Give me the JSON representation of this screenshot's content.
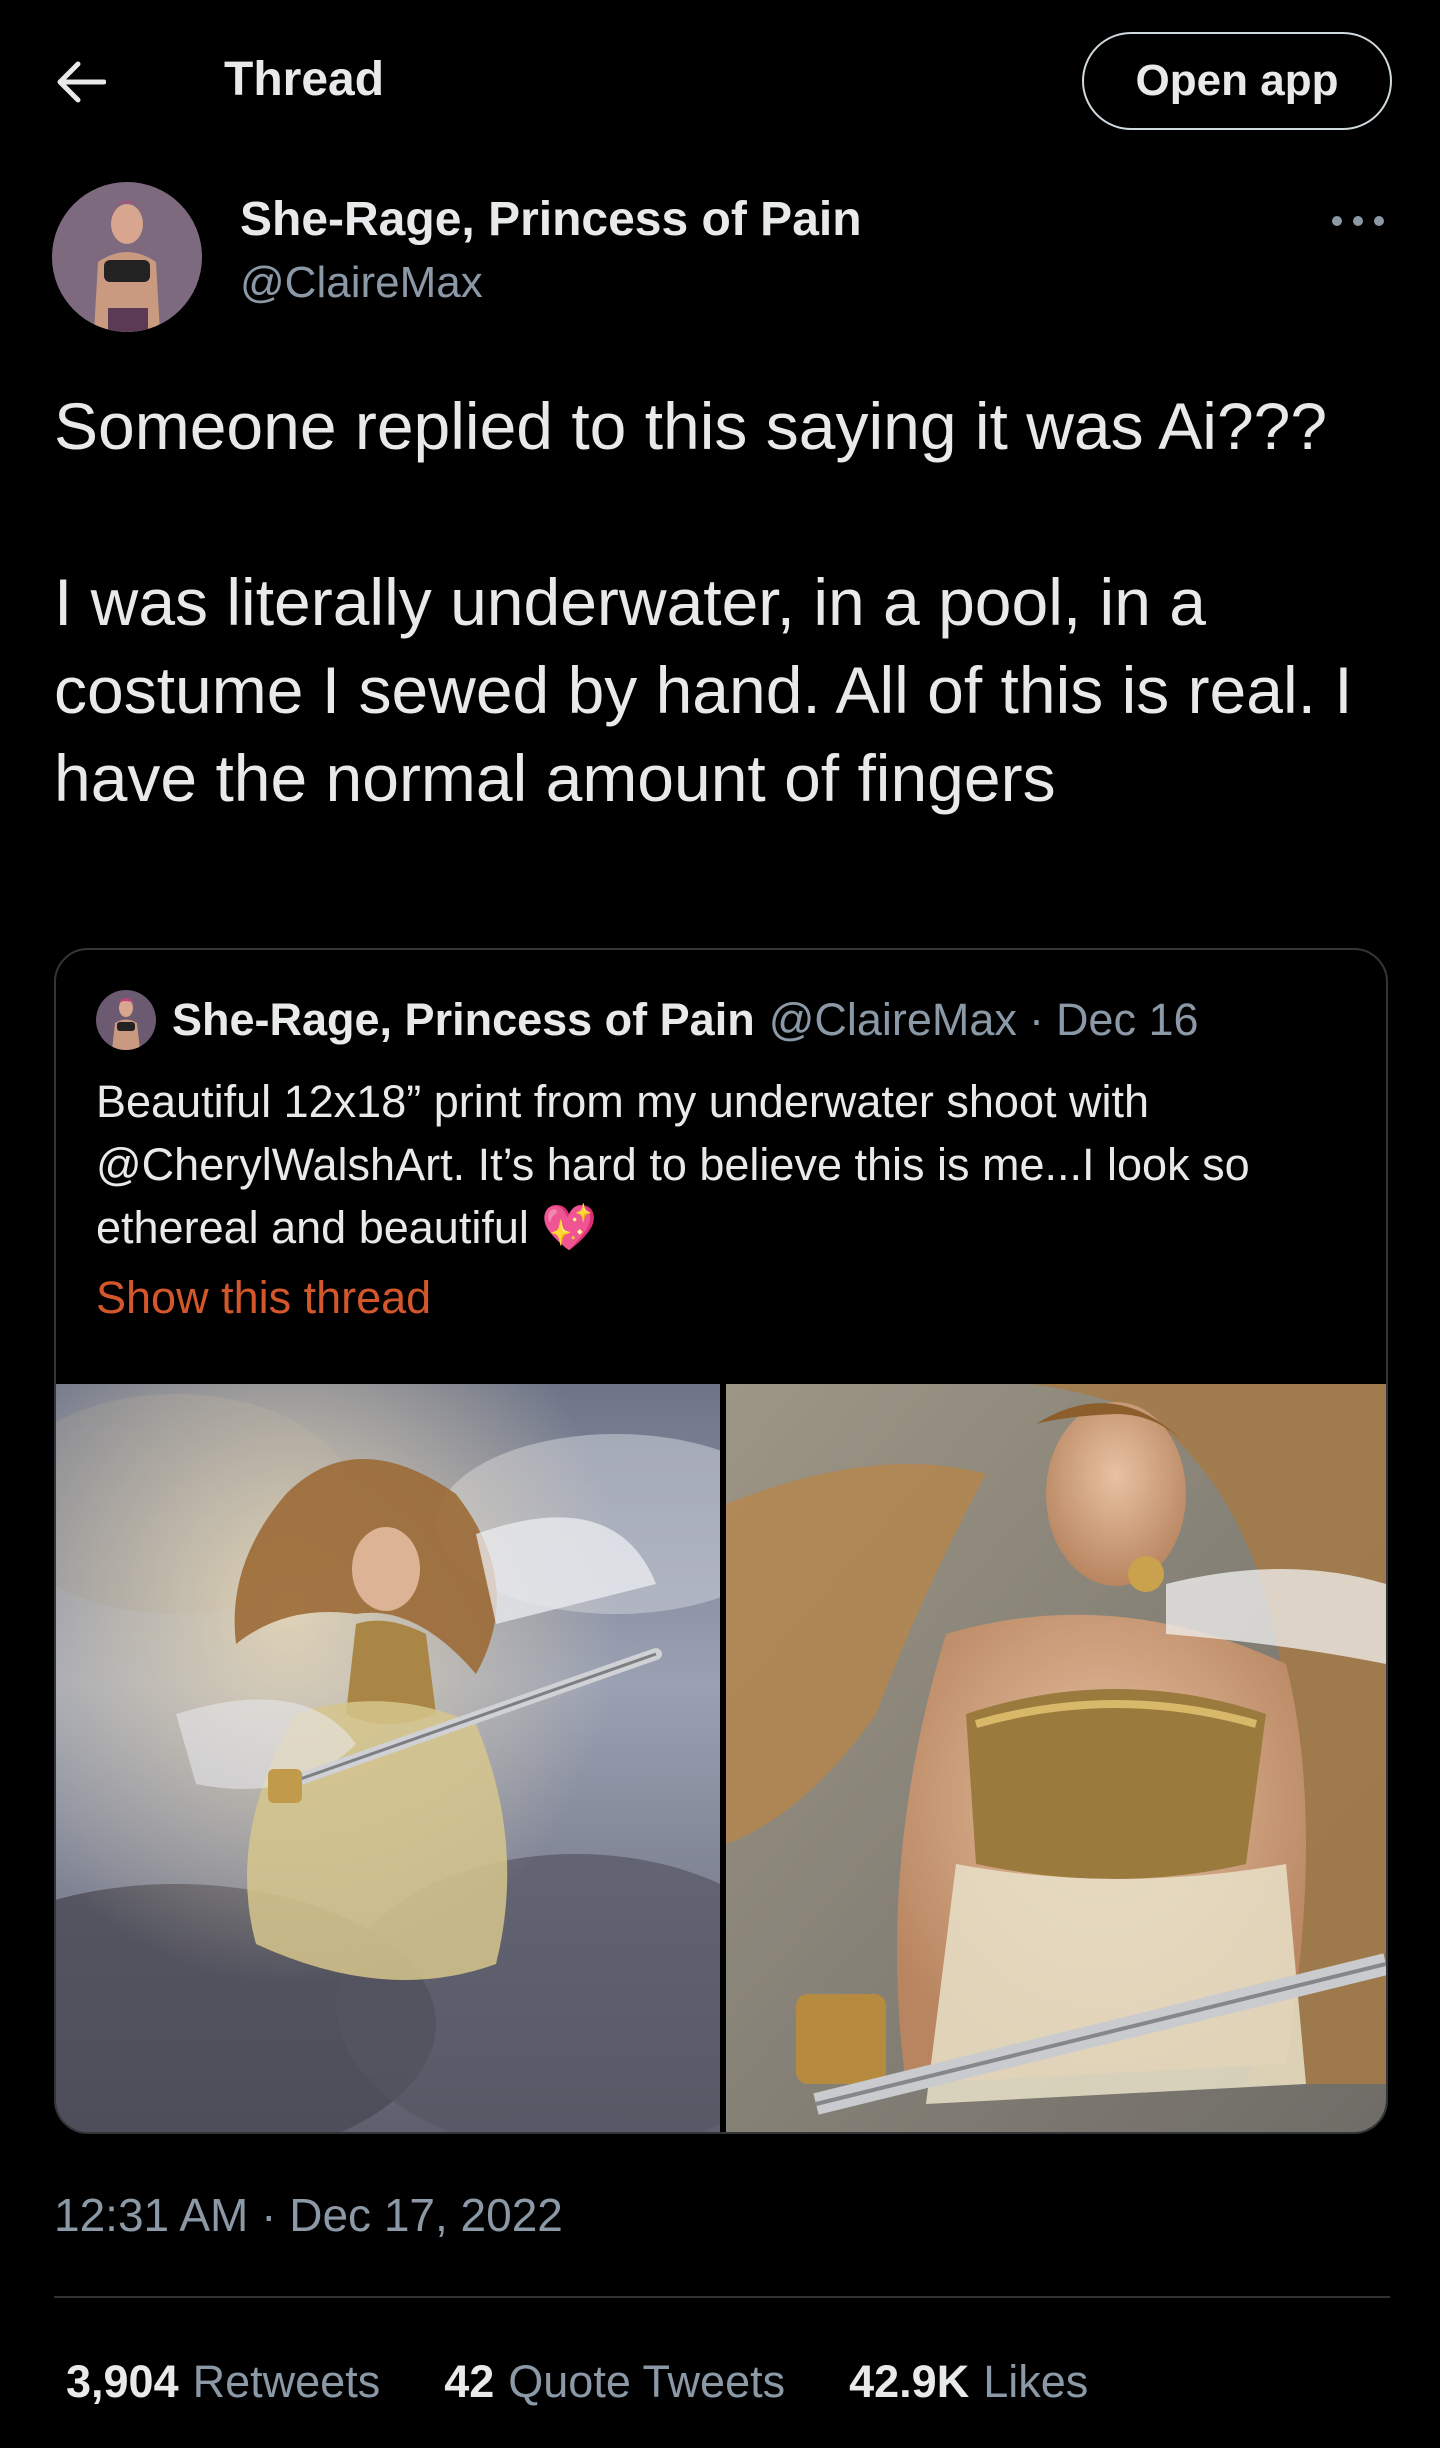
{
  "header": {
    "title": "Thread",
    "open_app_label": "Open app",
    "back_icon": "arrow-left-icon"
  },
  "tweet": {
    "author_name": "She-Rage, Princess of Pain",
    "author_handle": "@ClaireMax",
    "text_paragraphs": [
      "Someone replied to this saying it was Ai???",
      "I was literally underwater, in a pool, in a costume I sewed by hand. All of this is real. I have the normal amount of fingers"
    ],
    "timestamp": "12:31 AM · Dec 17, 2022"
  },
  "quote": {
    "author_name": "She-Rage, Princess of Pain",
    "author_handle": "@ClaireMax",
    "separator": "·",
    "date": "Dec 16",
    "text": "Beautiful 12x18” print from my underwater shoot with @CherylWalshArt. It’s hard to believe this is me...I look so ethereal and beautiful",
    "emoji": "💖",
    "show_thread_label": "Show this thread",
    "link_color": "#d4572b"
  },
  "stats": {
    "retweets_count": "3,904",
    "retweets_label": "Retweets",
    "quotes_count": "42",
    "quotes_label": "Quote Tweets",
    "likes_count": "42.9K",
    "likes_label": "Likes"
  },
  "colors": {
    "background": "#000000",
    "text_primary": "#e7e9ea",
    "text_secondary": "#8b98a5",
    "border": "#333639"
  }
}
